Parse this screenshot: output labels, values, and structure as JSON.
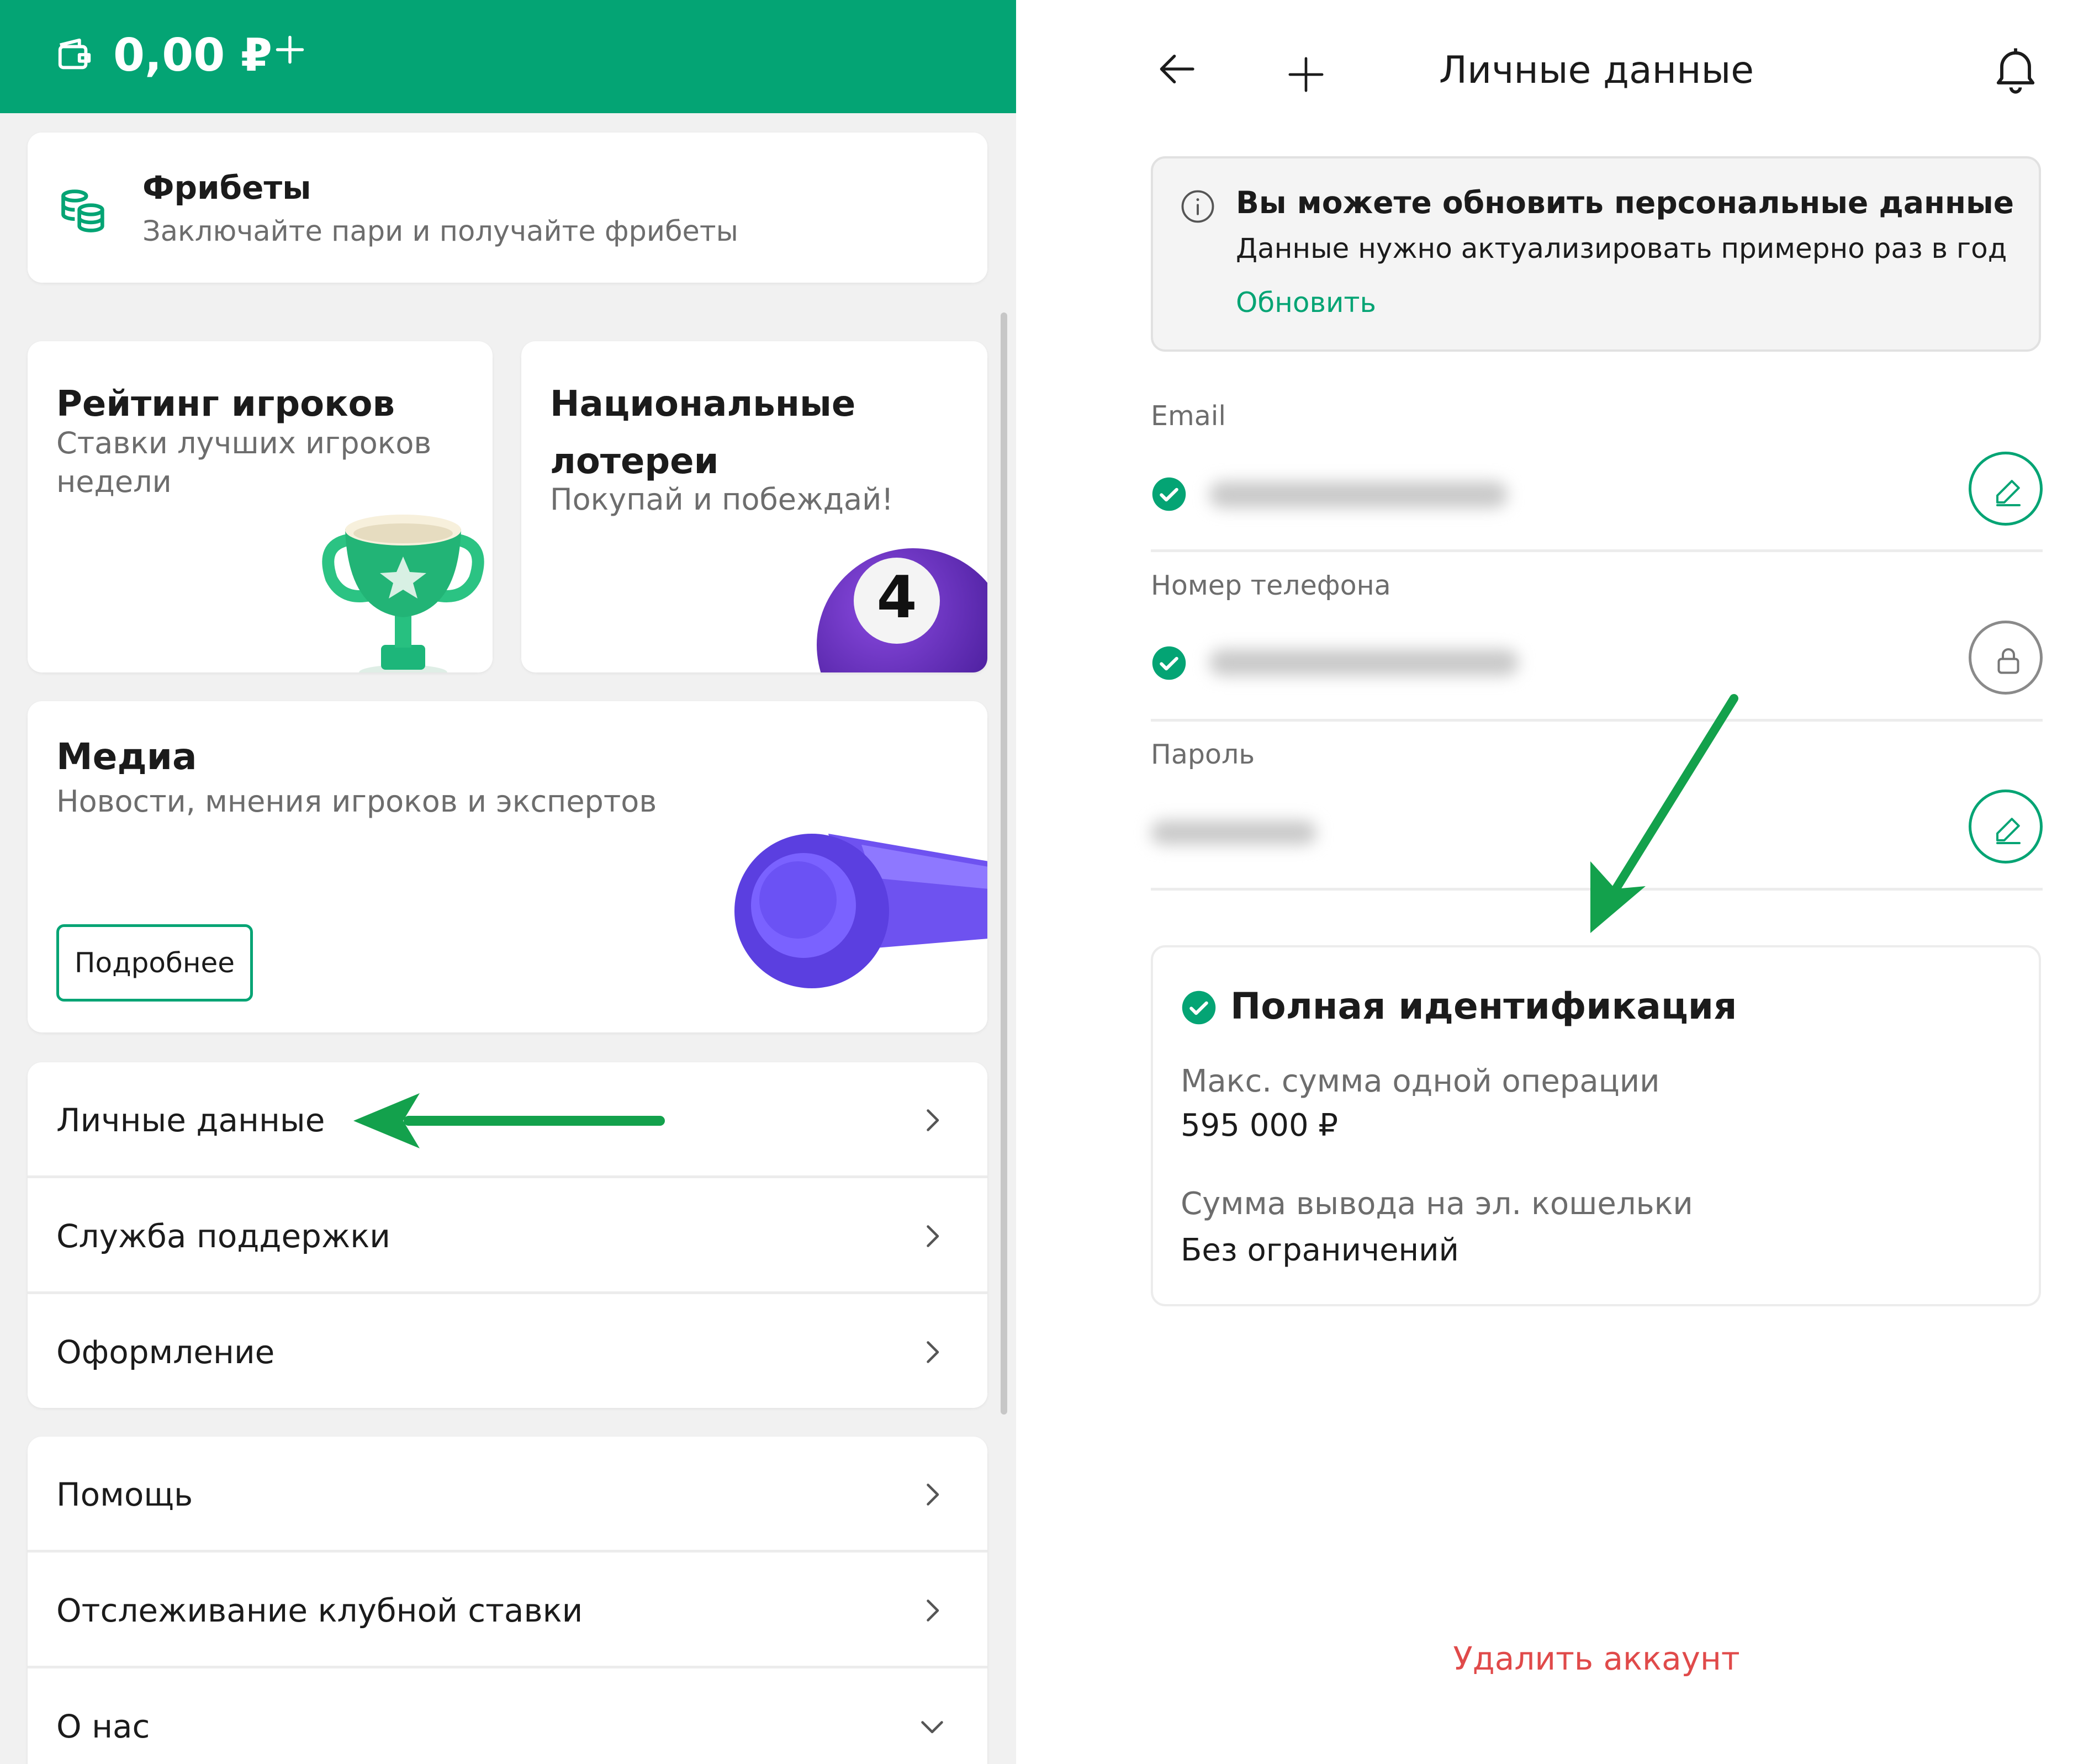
{
  "colors": {
    "brand": "#04a474",
    "danger": "#e04a4a",
    "muted": "#6d6d6d"
  },
  "left": {
    "header": {
      "balance": "0,00 ₽",
      "wallet_icon": "wallet-icon",
      "plus_icon": "plus-icon"
    },
    "freebets": {
      "title": "Фрибеты",
      "subtitle": "Заключайте пари и получайте фрибеты",
      "icon": "coins-icon"
    },
    "tiles": [
      {
        "title": "Рейтинг игроков",
        "subtitle": "Ставки лучших игроков недели",
        "image": "trophy"
      },
      {
        "title": "Национальные лотереи",
        "subtitle": "Покупай и побеждай!",
        "image": "lottery-ball-4",
        "ball_number": "4"
      }
    ],
    "media": {
      "title": "Медиа",
      "subtitle": "Новости, мнения игроков и экспертов",
      "button": "Подробнее",
      "image": "whistle"
    },
    "menu_group_1": [
      {
        "label": "Личные данные",
        "icon": "chevron-right-icon"
      },
      {
        "label": "Служба поддержки",
        "icon": "chevron-right-icon"
      },
      {
        "label": "Оформление",
        "icon": "chevron-right-icon"
      }
    ],
    "menu_group_2": [
      {
        "label": "Помощь",
        "icon": "chevron-right-icon"
      },
      {
        "label": "Отслеживание клубной ставки",
        "icon": "chevron-right-icon"
      },
      {
        "label": "О нас",
        "icon": "chevron-down-icon"
      }
    ]
  },
  "right": {
    "header": {
      "title": "Личные данные",
      "back_icon": "arrow-left-icon",
      "plus_icon": "plus-icon",
      "bell_icon": "bell-icon"
    },
    "notice": {
      "title": "Вы можете обновить персональные данные",
      "text": "Данные нужно актуализировать примерно раз в год",
      "link": "Обновить"
    },
    "fields": {
      "email": {
        "label": "Email",
        "verified": true,
        "action_icon": "pencil-icon"
      },
      "phone": {
        "label": "Номер телефона",
        "verified": true,
        "action_icon": "lock-icon"
      },
      "password": {
        "label": "Пароль",
        "action_icon": "pencil-icon"
      }
    },
    "identification": {
      "title": "Полная идентификация",
      "max_label": "Макс. сумма одной операции",
      "max_value": "595 000 ₽",
      "withdraw_label": "Сумма вывода на эл. кошельки",
      "withdraw_value": "Без ограничений"
    },
    "delete_account": "Удалить аккаунт"
  }
}
